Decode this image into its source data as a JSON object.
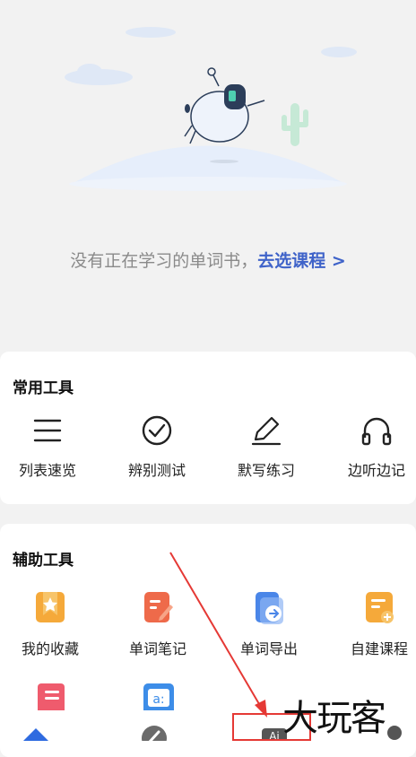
{
  "empty_state": {
    "message": "没有正在学习的单词书，",
    "link_label": "去选课程 >"
  },
  "common_tools": {
    "title": "常用工具",
    "items": [
      {
        "label": "列表速览",
        "icon": "list-icon"
      },
      {
        "label": "辨别测试",
        "icon": "check-circle-icon"
      },
      {
        "label": "默写练习",
        "icon": "pencil-icon"
      },
      {
        "label": "边听边记",
        "icon": "headphones-icon"
      }
    ]
  },
  "aux_tools": {
    "title": "辅助工具",
    "items": [
      {
        "label": "我的收藏",
        "icon": "star-bookmark-icon"
      },
      {
        "label": "单词笔记",
        "icon": "note-pen-icon"
      },
      {
        "label": "单词导出",
        "icon": "export-icon"
      },
      {
        "label": "自建课程",
        "icon": "create-course-icon"
      },
      {
        "label": "",
        "icon": "red-book-icon"
      },
      {
        "label": "",
        "icon": "word-card-icon"
      }
    ]
  },
  "bottom_nav": {
    "items": [
      {
        "icon": "home-icon"
      },
      {
        "icon": "compass-icon"
      },
      {
        "icon": "ai-icon",
        "label": "Ai"
      },
      {
        "icon": "profile-icon"
      }
    ]
  },
  "watermark": "大玩客",
  "colors": {
    "link": "#3f63c9",
    "highlight_box": "#e53935",
    "arrow": "#e53935",
    "nav_active": "#2f6be0"
  }
}
